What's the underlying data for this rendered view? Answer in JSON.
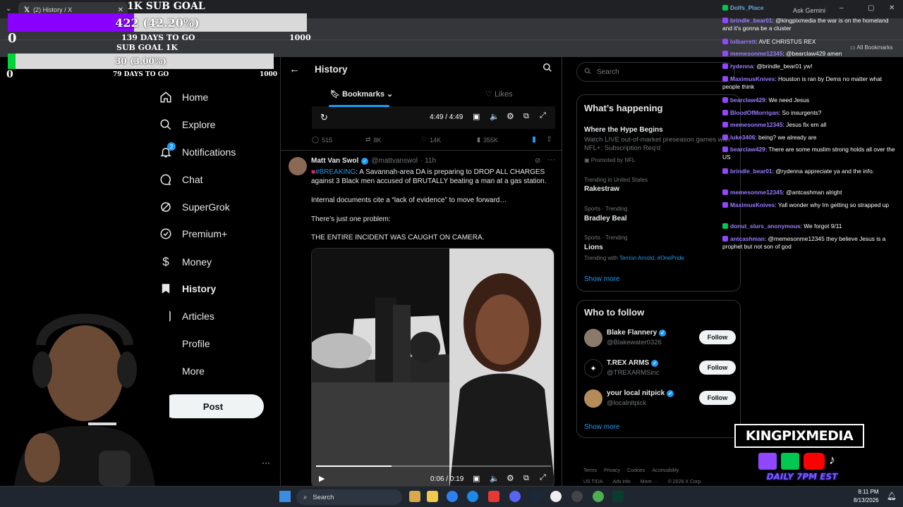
{
  "browser": {
    "tab_title": "(2) History / X",
    "ask_gemini": "Ask Gemini",
    "all_bookmarks": "All Bookmarks"
  },
  "overlay": {
    "goal1": {
      "title": "1K SUB GOAL",
      "progress_text": "422 (42.20%)",
      "progress": 0.422,
      "days": "139 DAYS TO GO",
      "min": "0",
      "max": "1000"
    },
    "goal2": {
      "title": "SUB GOAL 1K",
      "progress_text": "30 (3.00%)",
      "progress": 0.03,
      "days": "79 DAYS TO GO",
      "min": "0",
      "max": "1000"
    }
  },
  "nav": {
    "items": [
      {
        "label": "Home",
        "icon": "home-icon"
      },
      {
        "label": "Explore",
        "icon": "search-icon"
      },
      {
        "label": "Notifications",
        "icon": "bell-icon",
        "badge": "2"
      },
      {
        "label": "Chat",
        "icon": "chat-icon"
      },
      {
        "label": "SuperGrok",
        "icon": "grok-icon"
      },
      {
        "label": "Premium+",
        "icon": "premium-icon"
      },
      {
        "label": "Money",
        "icon": "money-icon"
      },
      {
        "label": "History",
        "icon": "bookmark-icon",
        "active": true
      },
      {
        "label": "Articles",
        "icon": "articles-icon"
      },
      {
        "label": "Profile",
        "icon": "profile-icon"
      },
      {
        "label": "More",
        "icon": "more-icon"
      }
    ],
    "post_label": "Post"
  },
  "main": {
    "title": "History",
    "tabs": [
      {
        "label": "Bookmarks"
      },
      {
        "label": "Likes"
      }
    ],
    "video1": {
      "time": "4:49 / 4:49"
    },
    "stats": {
      "replies": "515",
      "reposts": "8K",
      "likes": "14K",
      "views": "355K"
    },
    "tweet": {
      "author": "Matt Van Swol",
      "handle": "@mattvanswol",
      "time": "· 11h",
      "hashtag": "#BREAKING",
      "text1": ": A Savannah-area DA is preparing to DROP ALL CHARGES against 3 Black men accused of BRUTALLY beating a man at a gas station.",
      "text2": "Internal documents cite a “lack of evidence” to move forward…",
      "text3": "There’s just one problem:",
      "text4": "THE ENTIRE INCIDENT WAS CAUGHT ON CAMERA.",
      "video_time": "0:06 / 0:19",
      "video_progress": 0.32
    }
  },
  "right": {
    "search_placeholder": "Search",
    "happening": {
      "title": "What’s happening",
      "promo_title": "Where the Hype Begins",
      "promo_desc": "Watch LIVE out-of-market preseason games with NFL+. Subscription Req'd",
      "promo_by": "Promoted by NFL",
      "trends": [
        {
          "meta": "Trending in United States",
          "name": "Rakestraw"
        },
        {
          "meta": "Sports · Trending",
          "name": "Bradley Beal"
        },
        {
          "meta": "Sports · Trending",
          "name": "Lions",
          "with_prefix": "Trending with",
          "with": "Terrion Arnold, #OnePride"
        }
      ],
      "show_more": "Show more"
    },
    "who": {
      "title": "Who to follow",
      "people": [
        {
          "name": "Blake Flannery",
          "handle": "@Blakewater0326",
          "follow": "Follow"
        },
        {
          "name": "T.REX ARMS",
          "handle": "@TREXARMSinc",
          "follow": "Follow"
        },
        {
          "name": "your local nitpick",
          "handle": "@localnitpick",
          "follow": "Follow"
        }
      ],
      "show_more": "Show more"
    },
    "footer": [
      "Terms",
      "Privacy",
      "Cookies",
      "Accessibility"
    ],
    "footer2": [
      "US TIDA",
      "Ads info",
      "More ···",
      "© 2026 X Corp."
    ]
  },
  "chat": [
    {
      "user": "Dolfs_Place",
      "text": "",
      "badge": "green"
    },
    {
      "user": "brindle_bear01",
      "text": "@kingpixmedia the war is on the homeland and it's gonna be a cluster",
      "badge": "purple"
    },
    {
      "user": "lolbarrett",
      "text": "AVE CHRISTUS REX",
      "badge": "purple"
    },
    {
      "user": "memesonme12345",
      "text": "@bearclaw429 amen",
      "badge": "purple"
    },
    {
      "user": "rydenna",
      "text": "@brindle_bear01 yw!",
      "badge": "purple"
    },
    {
      "user": "MaximusKnives",
      "text": "Houston is ran by Dems no matter what people think",
      "badge": "purple"
    },
    {
      "user": "bearclaw429",
      "text": "We need Jesus",
      "badge": "purple"
    },
    {
      "user": "BloodOfMorrigan",
      "text": "So insurgents?",
      "badge": "purple"
    },
    {
      "user": "memesonme12345",
      "text": "Jesus fix em all",
      "badge": "purple"
    },
    {
      "user": "luke3406",
      "text": "being? we already are",
      "badge": "purple"
    },
    {
      "user": "bearclaw429",
      "text": "There are some muslim strong holds all over the US",
      "badge": "purple"
    },
    {
      "user": "brindle_bear01",
      "text": "@rydenna appreciate ya and the info.",
      "badge": "purple"
    },
    {
      "user": "memesonme12345",
      "text": "@antcashman alright",
      "badge": "purple"
    },
    {
      "user": "MaximusKnives",
      "text": "Yall wonder why Im getting so strapped up",
      "badge": "purple"
    },
    {
      "user": "donut_slurs_anonymous",
      "text": "We forgot 9/11",
      "badge": "green"
    },
    {
      "user": "antcashman",
      "text": "@memesonme12345 they believe Jesus is a prophet but not son of god",
      "badge": "purple"
    }
  ],
  "branding": {
    "logo": "KINGPIXMEDIA",
    "tagline": "DAILY 7PM EST"
  },
  "taskbar": {
    "search": "Search",
    "time": "8:11 PM",
    "date": "8/13/2026"
  },
  "colors": {
    "accent": "#1d9bf0",
    "goal1_fill": "#8a00ff",
    "goal2_fill": "#00d43b",
    "twitch": "#9147ff"
  }
}
